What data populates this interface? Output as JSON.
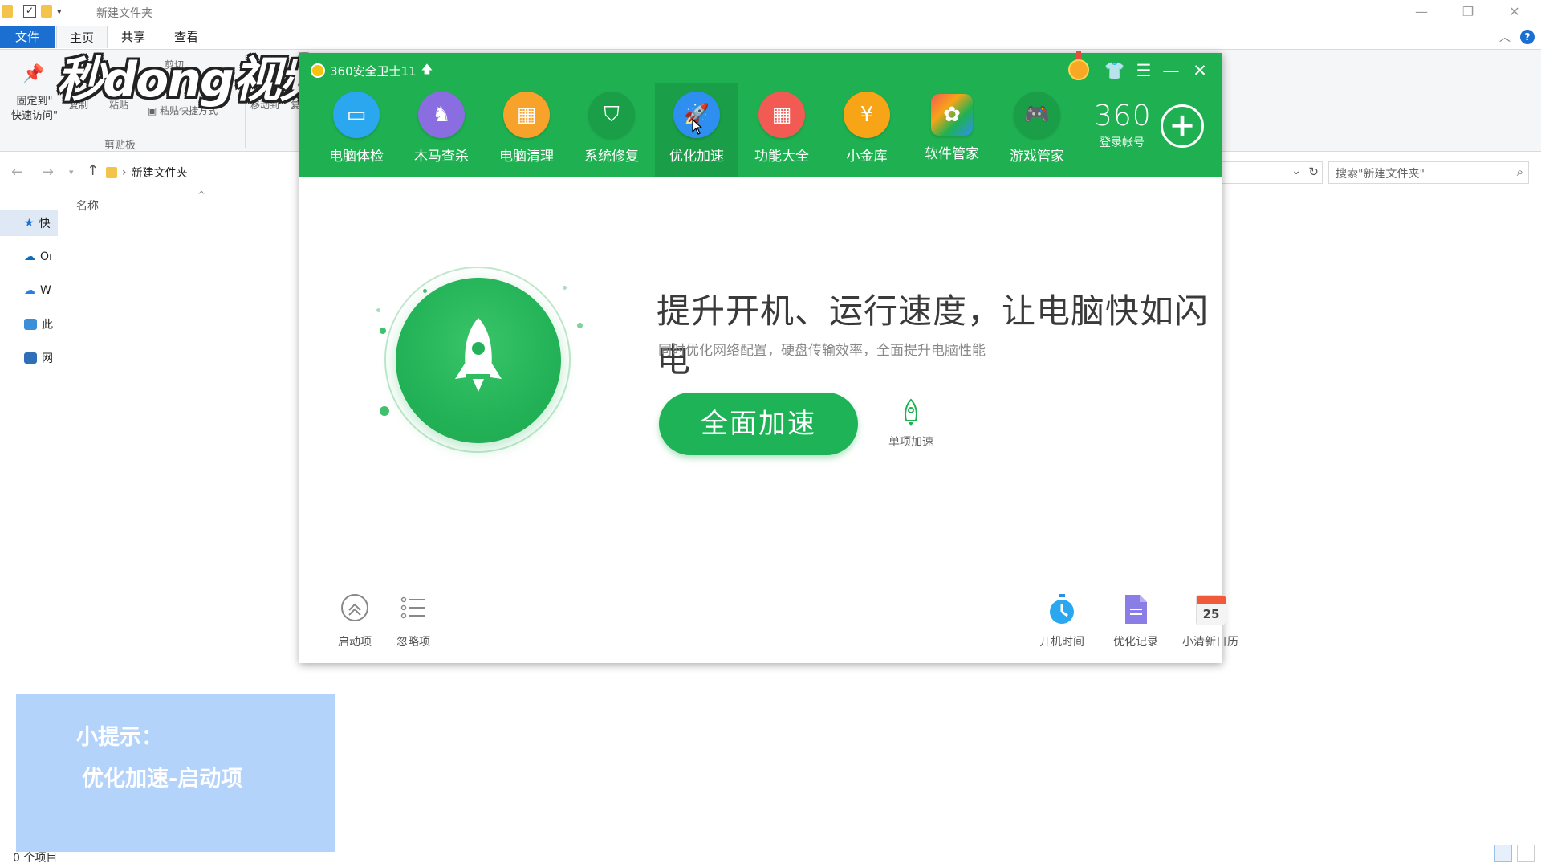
{
  "explorer": {
    "window_title": "新建文件夹",
    "tabs": {
      "file": "文件",
      "home": "主页",
      "share": "共享",
      "view": "查看"
    },
    "ribbon": {
      "pin_label_1": "固定到\"",
      "pin_label_2": "快速访问\"",
      "cut": "剪切",
      "copy": "复制",
      "paste": "粘贴",
      "paste_shortcut": "粘贴快捷方式",
      "move_to": "移动到",
      "copy_to": "复",
      "group_clipboard": "剪贴板"
    },
    "address": {
      "path": "新建文件夹"
    },
    "search_placeholder": "搜索\"新建文件夹\"",
    "nav_items": [
      "快",
      "Oı",
      "W",
      "此",
      "网"
    ],
    "column_name": "名称",
    "status": "0 个项目"
  },
  "watermark": "秒dong视频",
  "tip": {
    "line1": "小提示：",
    "line2": "优化加速-启动项"
  },
  "app360": {
    "title": "360安全卫士11",
    "nav": [
      {
        "label": "电脑体检",
        "icon": "monitor-icon",
        "color": "#2ba7f0"
      },
      {
        "label": "木马查杀",
        "icon": "horse-icon",
        "color": "#8a6de0"
      },
      {
        "label": "电脑清理",
        "icon": "broom-icon",
        "color": "#f7a22b"
      },
      {
        "label": "系统修复",
        "icon": "shield-icon",
        "color": "#1a9f48"
      },
      {
        "label": "优化加速",
        "icon": "rocket-icon",
        "color": "#2f8ff0"
      },
      {
        "label": "功能大全",
        "icon": "grid-icon",
        "color": "#f25b54"
      },
      {
        "label": "小金库",
        "icon": "coin-icon",
        "color": "#f7a417"
      },
      {
        "label": "软件管家",
        "icon": "apps-icon",
        "color": "#ffffff"
      },
      {
        "label": "游戏管家",
        "icon": "gamepad-icon",
        "color": "#1a9f48"
      }
    ],
    "account_number": "360",
    "account_label": "登录帐号",
    "headline": "提升开机、运行速度，让电脑快如闪电",
    "subtitle": "同时优化网络配置，硬盘传输效率，全面提升电脑性能",
    "main_button": "全面加速",
    "single_label": "单项加速",
    "bottom_left": [
      "启动项",
      "忽略项"
    ],
    "bottom_right": [
      "开机时间",
      "优化记录",
      "小清新日历"
    ],
    "calendar_day": "25",
    "accent": "#1fb151"
  }
}
